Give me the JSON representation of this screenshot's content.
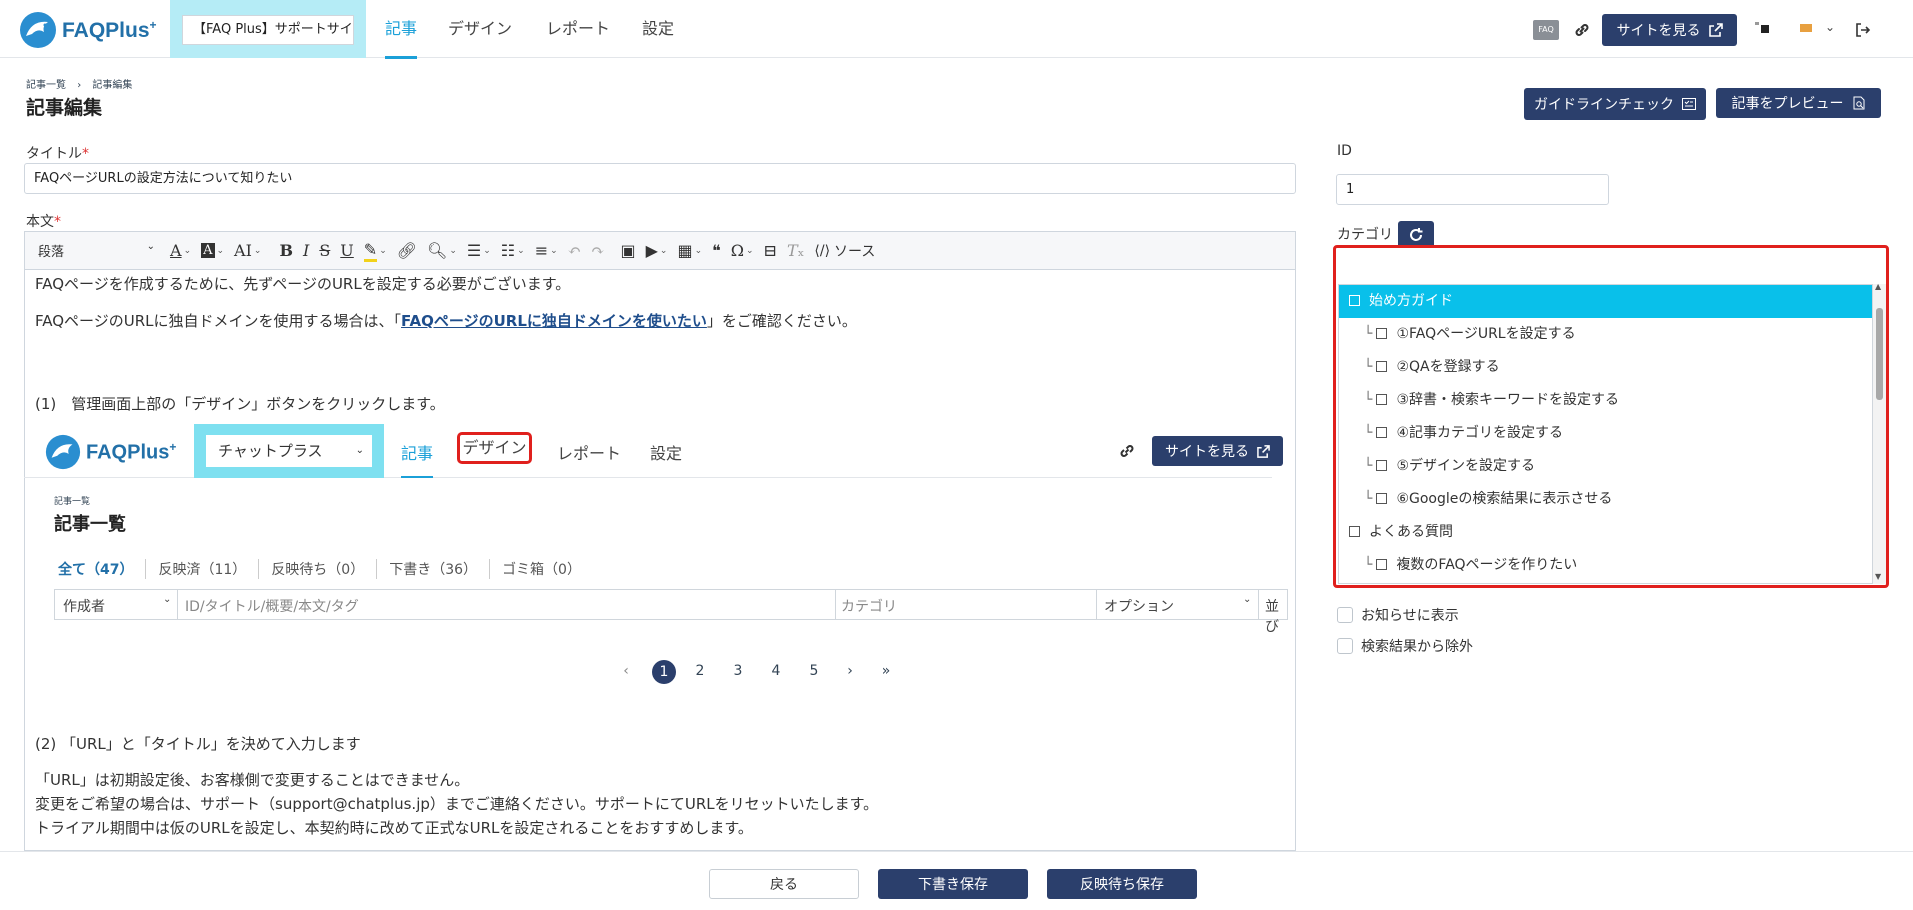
{
  "app": {
    "logo": "FAQPlus",
    "logo_sup": "+"
  },
  "header": {
    "site_select": "【FAQ Plus】サポートサイト",
    "tabs": [
      "記事",
      "デザイン",
      "レポート",
      "設定"
    ],
    "faq_badge": "FAQ",
    "view_site": "サイトを見る"
  },
  "breadcrumb": {
    "parent": "記事一覧",
    "sep": "›",
    "current": "記事編集"
  },
  "page_title": "記事編集",
  "actions": {
    "guideline": "ガイドラインチェック",
    "preview": "記事をプレビュー"
  },
  "form": {
    "title_label": "タイトル",
    "required_mark": "*",
    "title_value": "FAQページURLの設定方法について知りたい",
    "body_label": "本文",
    "id_label": "ID",
    "id_value": "1",
    "category_label": "カテゴリ"
  },
  "toolbar": {
    "paragraph": "段落",
    "source": "ソース"
  },
  "content": {
    "p1": "FAQページを作成するために、先ずページのURLを設定する必要がございます。",
    "p2_pre": "FAQページのURLに独自ドメインを使用する場合は、「",
    "p2_link": "FAQページのURLに独自ドメインを使いたい",
    "p2_post": "」をご確認ください。",
    "step1": "(1)　管理画面上部の「デザイン」ボタンをクリックします。",
    "step2": "(2) 「URL」と「タイトル」を決めて入力します",
    "p3": "「URL」は初期設定後、お客様側で変更することはできません。",
    "p4": "変更をご希望の場合は、サポート（support@chatplus.jp）までご連絡ください。サポートにてURLをリセットいたします。",
    "p5": "トライアル期間中は仮のURLを設定し、本契約時に改めて正式なURLを設定されることをおすすめします。"
  },
  "embedded": {
    "site_select": "チャットプラス",
    "tabs": [
      "記事",
      "デザイン",
      "レポート",
      "設定"
    ],
    "view_site": "サイトを見る",
    "crumb": "記事一覧",
    "title": "記事一覧",
    "filters": [
      "全て（47）",
      "反映済（11）",
      "反映待ち（0）",
      "下書き（36）",
      "ゴミ箱（0）"
    ],
    "search": {
      "author": "作成者",
      "query_placeholder": "ID/タイトル/概要/本文/タグ",
      "category": "カテゴリ",
      "option": "オプション",
      "sort": "並び"
    },
    "pagination": [
      "‹",
      "1",
      "2",
      "3",
      "4",
      "5",
      "›",
      "»"
    ]
  },
  "categories": [
    {
      "label": "始め方ガイド",
      "level": 0,
      "selected": true
    },
    {
      "label": "①FAQページURLを設定する",
      "level": 1
    },
    {
      "label": "②QAを登録する",
      "level": 1
    },
    {
      "label": "③辞書・検索キーワードを設定する",
      "level": 1
    },
    {
      "label": "④記事カテゴリを設定する",
      "level": 1
    },
    {
      "label": "⑤デザインを設定する",
      "level": 1
    },
    {
      "label": "⑥Googleの検索結果に表示させる",
      "level": 1
    },
    {
      "label": "よくある質問",
      "level": 0
    },
    {
      "label": "複数のFAQページを作りたい",
      "level": 1
    }
  ],
  "tree_prefix": "└",
  "options": {
    "show_news": "お知らせに表示",
    "exclude_search": "検索結果から除外"
  },
  "footer": {
    "back": "戻る",
    "save_draft": "下書き保存",
    "save_pending": "反映待ち保存"
  },
  "colors": {
    "navy": "#2b3f6c",
    "accent": "#1ba0d8",
    "highlight": "#09c0ea",
    "alert": "#e0201d"
  }
}
